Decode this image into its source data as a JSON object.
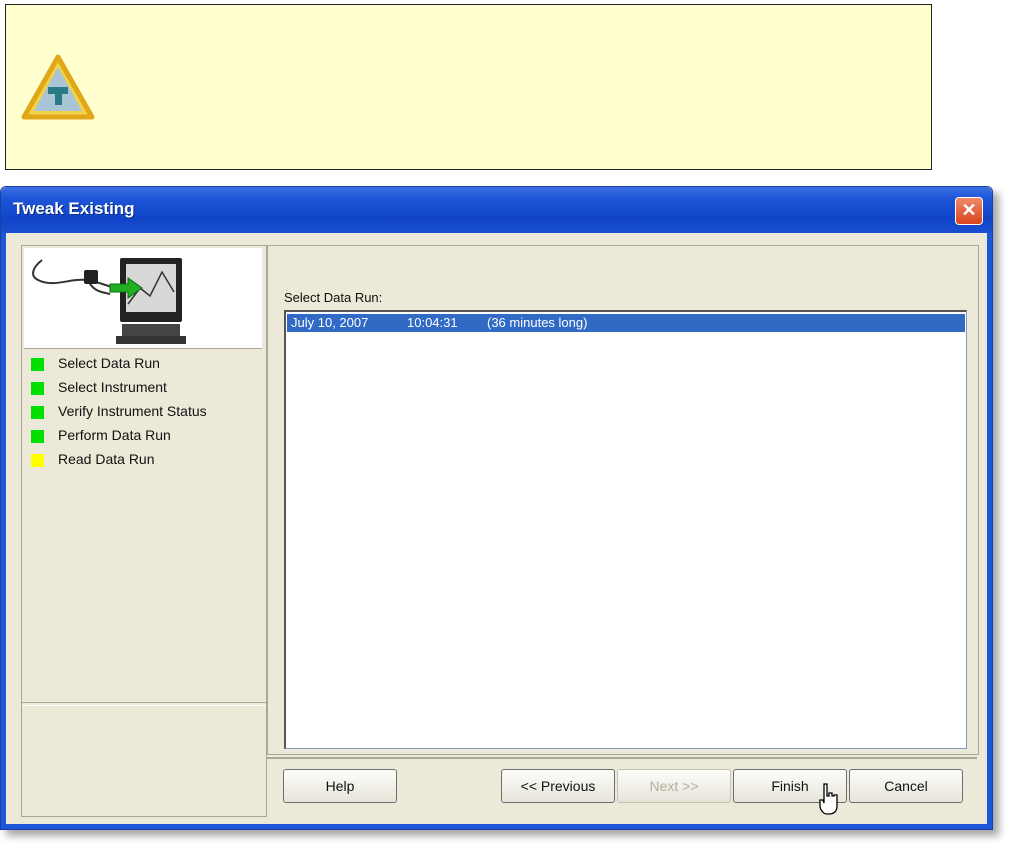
{
  "tip": {
    "icon": "tip-warning-triangle-icon",
    "background_color": "#ffffd0"
  },
  "window": {
    "title": "Tweak Existing",
    "close_label": "✕",
    "title_color": "#1e56d8"
  },
  "wizard": {
    "illustration": "instrument-to-computer-icon",
    "steps": [
      {
        "label": "Select Data Run",
        "status": "complete",
        "color": "#00e000"
      },
      {
        "label": "Select Instrument",
        "status": "complete",
        "color": "#00e000"
      },
      {
        "label": "Verify Instrument Status",
        "status": "complete",
        "color": "#00e000"
      },
      {
        "label": "Perform Data Run",
        "status": "complete",
        "color": "#00e000"
      },
      {
        "label": "Read Data Run",
        "status": "current",
        "color": "#ffff00"
      }
    ]
  },
  "main": {
    "select_label": "Select Data Run:",
    "runs": [
      {
        "date": "July 10, 2007",
        "time": "10:04:31",
        "duration": "(36 minutes long)",
        "selected": true
      }
    ],
    "selection_color": "#316ac5"
  },
  "buttons": {
    "help": "Help",
    "previous": "<< Previous",
    "next": "Next >>",
    "finish": "Finish",
    "cancel": "Cancel"
  }
}
